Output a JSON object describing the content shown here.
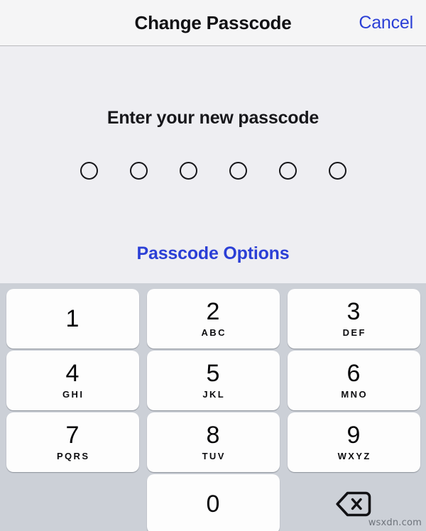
{
  "header": {
    "title": "Change Passcode",
    "cancel_label": "Cancel",
    "background_color": "#f5f5f6",
    "accent_color": "#2b3fd6"
  },
  "content": {
    "prompt": "Enter your new passcode",
    "passcode_dots": {
      "count": 6,
      "filled": 0
    },
    "options_link": "Passcode Options",
    "background_color": "#eeeef2"
  },
  "keypad": {
    "background_color": "#ccd0d7",
    "key_color": "#fdfdfd",
    "keys": [
      {
        "digit": "1",
        "letters": ""
      },
      {
        "digit": "2",
        "letters": "ABC"
      },
      {
        "digit": "3",
        "letters": "DEF"
      },
      {
        "digit": "4",
        "letters": "GHI"
      },
      {
        "digit": "5",
        "letters": "JKL"
      },
      {
        "digit": "6",
        "letters": "MNO"
      },
      {
        "digit": "7",
        "letters": "PQRS"
      },
      {
        "digit": "8",
        "letters": "TUV"
      },
      {
        "digit": "9",
        "letters": "WXYZ"
      },
      {
        "digit": "0",
        "letters": ""
      }
    ],
    "delete_icon": "backspace-icon"
  },
  "watermark": "wsxdn.com"
}
